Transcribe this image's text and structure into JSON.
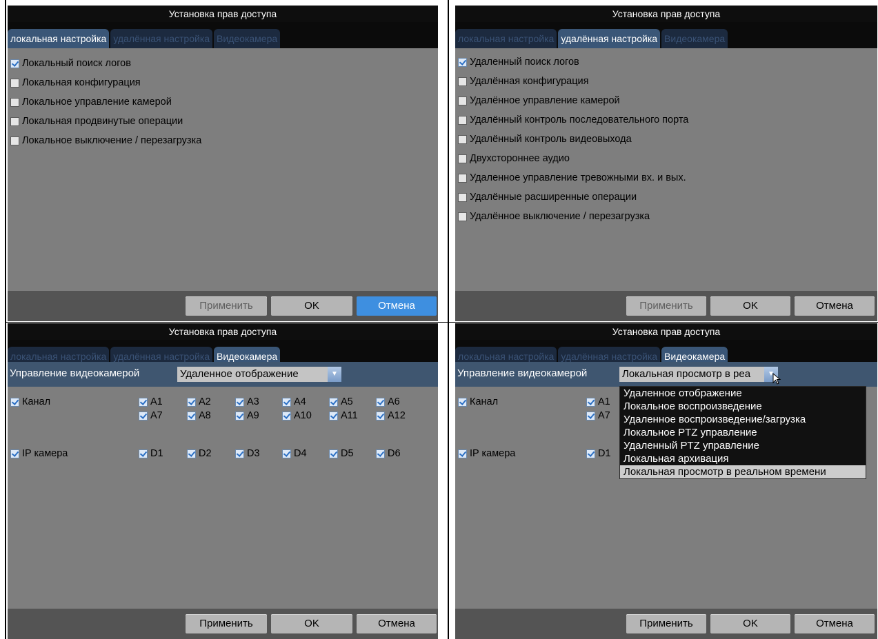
{
  "panels": [
    {
      "title": "Установка прав доступа",
      "tabs": [
        "локальная настройка",
        "удалённая настройка",
        "Видеокамера"
      ],
      "active_tab": 0,
      "options": [
        {
          "label": "Локальный поиск логов",
          "checked": true
        },
        {
          "label": "Локальная конфигурация",
          "checked": false
        },
        {
          "label": "Локальное управление камерой",
          "checked": false
        },
        {
          "label": "Локальная продвинутые операции",
          "checked": false
        },
        {
          "label": "Локальное выключение / перезагрузка",
          "checked": false
        }
      ],
      "buttons": {
        "apply": "Применить",
        "ok": "OK",
        "cancel": "Отмена"
      }
    },
    {
      "title": "Установка прав доступа",
      "tabs": [
        "локальная настройка",
        "удалённая настройка",
        "Видеокамера"
      ],
      "active_tab": 1,
      "options": [
        {
          "label": "Удаленный поиск логов",
          "checked": true
        },
        {
          "label": "Удалённая конфигурация",
          "checked": false
        },
        {
          "label": "Удалённое управление камерой",
          "checked": false
        },
        {
          "label": "Удалённый контроль последовательного порта",
          "checked": false
        },
        {
          "label": "Удалённый контроль видеовыхода",
          "checked": false
        },
        {
          "label": "Двухстороннее аудио",
          "checked": false
        },
        {
          "label": "Удаленное управление тревожными вх. и вых.",
          "checked": false
        },
        {
          "label": "Удалённые расширенные операции",
          "checked": false
        },
        {
          "label": "Удалённое выключение / перезагрузка",
          "checked": false
        }
      ],
      "buttons": {
        "apply": "Применить",
        "ok": "OK",
        "cancel": "Отмена"
      }
    },
    {
      "title": "Установка прав доступа",
      "tabs": [
        "локальная настройка",
        "удалённая настройка",
        "Видеокамера"
      ],
      "active_tab": 2,
      "camera_control_label": "Управление видеокамерой",
      "camera_control_value": "Удаленное отображение",
      "channel_label": "Канал",
      "channel_checked": true,
      "channels": [
        "A1",
        "A2",
        "A3",
        "A4",
        "A5",
        "A6",
        "A7",
        "A8",
        "A9",
        "A10",
        "A11",
        "A12"
      ],
      "ip_camera_label": "IP камера",
      "ip_camera_checked": true,
      "ip_cameras": [
        "D1",
        "D2",
        "D3",
        "D4",
        "D5",
        "D6"
      ],
      "buttons": {
        "apply": "Применить",
        "ok": "OK",
        "cancel": "Отмена"
      }
    },
    {
      "title": "Установка прав доступа",
      "tabs": [
        "локальная настройка",
        "удалённая настройка",
        "Видеокамера"
      ],
      "active_tab": 2,
      "camera_control_label": "Управление видеокамерой",
      "camera_control_value": "Локальная просмотр в реа",
      "channel_label": "Канал",
      "channel_checked": true,
      "channels_visible": [
        "A1",
        "A7"
      ],
      "ip_camera_label": "IP камера",
      "ip_camera_checked": true,
      "ip_cameras_visible": [
        "D1"
      ],
      "dropdown_options": [
        "Удаленное отображение",
        "Локальное воспроизведение",
        "Удаленное воспроизведение/загрузка",
        "Локальное PTZ управление",
        "Удаленный PTZ управление",
        "Локальная архивация",
        "Локальная просмотр в реальном времени"
      ],
      "dropdown_selected": 6,
      "buttons": {
        "apply": "Применить",
        "ok": "OK",
        "cancel": "Отмена"
      }
    }
  ]
}
